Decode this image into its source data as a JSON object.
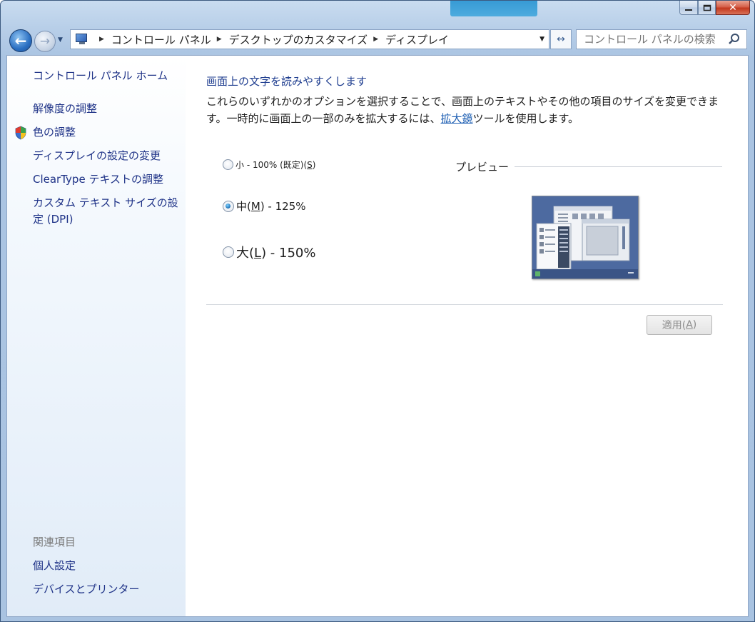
{
  "window": {
    "minimize_icon": "minimize-icon",
    "maximize_icon": "maximize-icon",
    "close_icon": "close-icon",
    "close_glyph": "✕"
  },
  "nav": {
    "back_glyph": "←",
    "forward_glyph": "→",
    "recent_glyph": "▼",
    "breadcrumb": [
      "コントロール パネル",
      "デスクトップのカスタマイズ",
      "ディスプレイ"
    ],
    "address_dropdown_glyph": "▼",
    "refresh_glyph": "↔",
    "search_placeholder": "コントロール パネルの検索"
  },
  "sidebar": {
    "home": "コントロール パネル ホーム",
    "items": [
      {
        "label": "解像度の調整"
      },
      {
        "label": "色の調整",
        "icon": "uac-shield-icon"
      },
      {
        "label": "ディスプレイの設定の変更"
      },
      {
        "label": "ClearType テキストの調整"
      },
      {
        "label": "カスタム テキスト サイズの設定 (DPI)"
      }
    ],
    "related_heading": "関連項目",
    "related": [
      {
        "label": "個人設定"
      },
      {
        "label": "デバイスとプリンター"
      }
    ]
  },
  "main": {
    "heading": "画面上の文字を読みやすくします",
    "desc_before": "これらのいずれかのオプションを選択することで、画面上のテキストやその他の項目のサイズを変更できます。一時的に画面上の一部のみを拡大するには、",
    "desc_link": "拡大鏡",
    "desc_after": "ツールを使用します。",
    "options": [
      {
        "label_a": "小 - 100% (既定)(",
        "mnemonic": "S",
        "label_b": ")",
        "checked": false
      },
      {
        "label_a": "中(",
        "mnemonic": "M",
        "label_b": ") - 125%",
        "checked": true
      },
      {
        "label_a": "大(",
        "mnemonic": "L",
        "label_b": ") - 150%",
        "checked": false
      }
    ],
    "preview_label": "プレビュー",
    "apply_a": "適用(",
    "apply_mnemonic": "A",
    "apply_b": ")"
  },
  "help_glyph": "?",
  "colors": {
    "link": "#1e3287",
    "heading": "#1e3d8f",
    "sidebar_bg_bottom": "#e1ecf8",
    "frame": "#a9c3e1"
  }
}
